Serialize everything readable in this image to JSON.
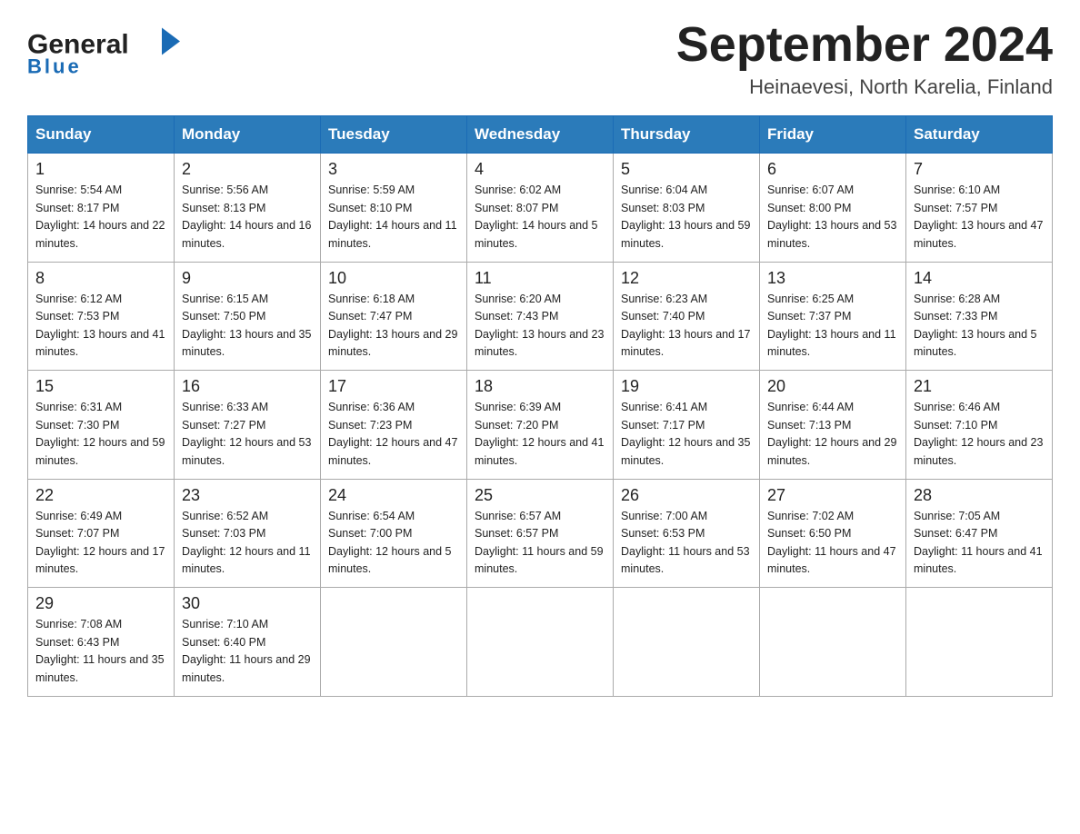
{
  "header": {
    "logo_general": "General",
    "logo_blue": "Blue",
    "month_title": "September 2024",
    "location": "Heinaevesi, North Karelia, Finland"
  },
  "days_of_week": [
    "Sunday",
    "Monday",
    "Tuesday",
    "Wednesday",
    "Thursday",
    "Friday",
    "Saturday"
  ],
  "weeks": [
    [
      {
        "day": "1",
        "sunrise": "5:54 AM",
        "sunset": "8:17 PM",
        "daylight": "14 hours and 22 minutes."
      },
      {
        "day": "2",
        "sunrise": "5:56 AM",
        "sunset": "8:13 PM",
        "daylight": "14 hours and 16 minutes."
      },
      {
        "day": "3",
        "sunrise": "5:59 AM",
        "sunset": "8:10 PM",
        "daylight": "14 hours and 11 minutes."
      },
      {
        "day": "4",
        "sunrise": "6:02 AM",
        "sunset": "8:07 PM",
        "daylight": "14 hours and 5 minutes."
      },
      {
        "day": "5",
        "sunrise": "6:04 AM",
        "sunset": "8:03 PM",
        "daylight": "13 hours and 59 minutes."
      },
      {
        "day": "6",
        "sunrise": "6:07 AM",
        "sunset": "8:00 PM",
        "daylight": "13 hours and 53 minutes."
      },
      {
        "day": "7",
        "sunrise": "6:10 AM",
        "sunset": "7:57 PM",
        "daylight": "13 hours and 47 minutes."
      }
    ],
    [
      {
        "day": "8",
        "sunrise": "6:12 AM",
        "sunset": "7:53 PM",
        "daylight": "13 hours and 41 minutes."
      },
      {
        "day": "9",
        "sunrise": "6:15 AM",
        "sunset": "7:50 PM",
        "daylight": "13 hours and 35 minutes."
      },
      {
        "day": "10",
        "sunrise": "6:18 AM",
        "sunset": "7:47 PM",
        "daylight": "13 hours and 29 minutes."
      },
      {
        "day": "11",
        "sunrise": "6:20 AM",
        "sunset": "7:43 PM",
        "daylight": "13 hours and 23 minutes."
      },
      {
        "day": "12",
        "sunrise": "6:23 AM",
        "sunset": "7:40 PM",
        "daylight": "13 hours and 17 minutes."
      },
      {
        "day": "13",
        "sunrise": "6:25 AM",
        "sunset": "7:37 PM",
        "daylight": "13 hours and 11 minutes."
      },
      {
        "day": "14",
        "sunrise": "6:28 AM",
        "sunset": "7:33 PM",
        "daylight": "13 hours and 5 minutes."
      }
    ],
    [
      {
        "day": "15",
        "sunrise": "6:31 AM",
        "sunset": "7:30 PM",
        "daylight": "12 hours and 59 minutes."
      },
      {
        "day": "16",
        "sunrise": "6:33 AM",
        "sunset": "7:27 PM",
        "daylight": "12 hours and 53 minutes."
      },
      {
        "day": "17",
        "sunrise": "6:36 AM",
        "sunset": "7:23 PM",
        "daylight": "12 hours and 47 minutes."
      },
      {
        "day": "18",
        "sunrise": "6:39 AM",
        "sunset": "7:20 PM",
        "daylight": "12 hours and 41 minutes."
      },
      {
        "day": "19",
        "sunrise": "6:41 AM",
        "sunset": "7:17 PM",
        "daylight": "12 hours and 35 minutes."
      },
      {
        "day": "20",
        "sunrise": "6:44 AM",
        "sunset": "7:13 PM",
        "daylight": "12 hours and 29 minutes."
      },
      {
        "day": "21",
        "sunrise": "6:46 AM",
        "sunset": "7:10 PM",
        "daylight": "12 hours and 23 minutes."
      }
    ],
    [
      {
        "day": "22",
        "sunrise": "6:49 AM",
        "sunset": "7:07 PM",
        "daylight": "12 hours and 17 minutes."
      },
      {
        "day": "23",
        "sunrise": "6:52 AM",
        "sunset": "7:03 PM",
        "daylight": "12 hours and 11 minutes."
      },
      {
        "day": "24",
        "sunrise": "6:54 AM",
        "sunset": "7:00 PM",
        "daylight": "12 hours and 5 minutes."
      },
      {
        "day": "25",
        "sunrise": "6:57 AM",
        "sunset": "6:57 PM",
        "daylight": "11 hours and 59 minutes."
      },
      {
        "day": "26",
        "sunrise": "7:00 AM",
        "sunset": "6:53 PM",
        "daylight": "11 hours and 53 minutes."
      },
      {
        "day": "27",
        "sunrise": "7:02 AM",
        "sunset": "6:50 PM",
        "daylight": "11 hours and 47 minutes."
      },
      {
        "day": "28",
        "sunrise": "7:05 AM",
        "sunset": "6:47 PM",
        "daylight": "11 hours and 41 minutes."
      }
    ],
    [
      {
        "day": "29",
        "sunrise": "7:08 AM",
        "sunset": "6:43 PM",
        "daylight": "11 hours and 35 minutes."
      },
      {
        "day": "30",
        "sunrise": "7:10 AM",
        "sunset": "6:40 PM",
        "daylight": "11 hours and 29 minutes."
      },
      null,
      null,
      null,
      null,
      null
    ]
  ]
}
